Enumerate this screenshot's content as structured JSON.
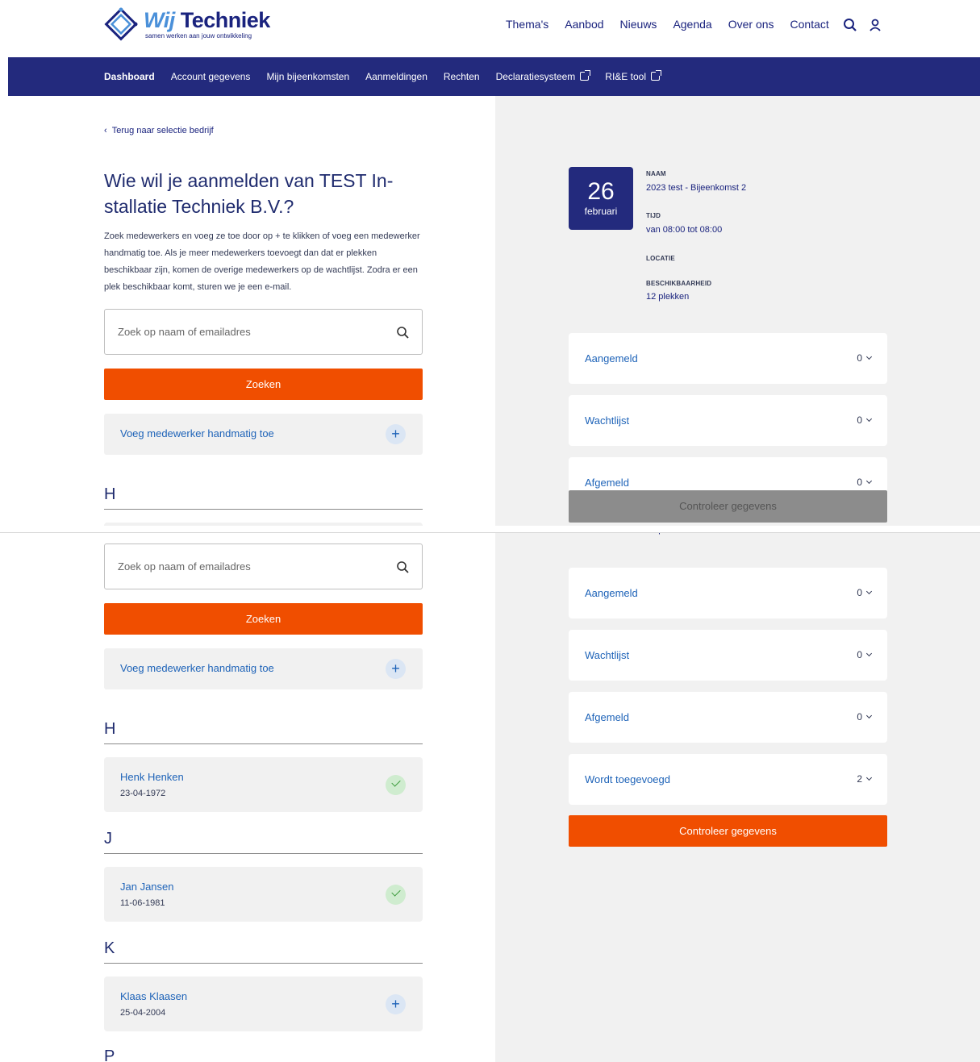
{
  "header": {
    "logo_word1": "Wij",
    "logo_word2": "Techniek",
    "logo_tagline": "samen werken aan jouw ontwikkeling",
    "nav": [
      "Thema's",
      "Aanbod",
      "Nieuws",
      "Agenda",
      "Over ons",
      "Contact"
    ],
    "icons": [
      "search-icon",
      "user-icon"
    ]
  },
  "subnav": {
    "items": [
      "Dashboard",
      "Account gegevens",
      "Mijn bijeenkomsten",
      "Aanmeldingen",
      "Rechten",
      "Declaratiesysteem",
      "RI&E tool"
    ],
    "active": "Dashboard",
    "accent": "#232a7d"
  },
  "left": {
    "back_link": "Terug naar selectie bedrijf",
    "title": "Wie wil je aanmelden van TEST In­stallatie Techniek B.V.?",
    "intro": "Zoek medewerkers en voeg ze toe door op + te klikken of voeg een mede­werker handmatig toe. Als je meer medewerkers toevoegt dan dat er plekken beschikbaar zijn, komen de overige medewerkers op de wacht­lijst. Zodra er een plek beschikbaar komt, sturen we je een e-mail.",
    "search_placeholder": "Zoek op naam of emailadres",
    "search_button": "Zoeken",
    "add_manual": "Voeg medewerker handmatig toe",
    "groups": [
      {
        "letter": "H",
        "people": [
          {
            "name": "Henk Henken",
            "date": "23-04-1972",
            "added": true
          }
        ]
      },
      {
        "letter": "J",
        "people": [
          {
            "name": "Jan Jansen",
            "date": "11-06-1981",
            "added": true
          }
        ]
      },
      {
        "letter": "K",
        "people": [
          {
            "name": "Klaas Klaasen",
            "date": "25-04-2004",
            "added": false
          }
        ]
      },
      {
        "letter": "P",
        "people": []
      }
    ]
  },
  "event": {
    "day": "26",
    "month": "februari",
    "naam_label": "NAAM",
    "naam": "2023 test - Bijeenkomst 2",
    "tijd_label": "TIJD",
    "tijd": "van 08:00 tot 08:00",
    "locatie_label": "LOCATIE",
    "beschikbaarheid_label": "BESCHIKBAARHEID",
    "beschikbaarheid": "12 plekken"
  },
  "status": [
    {
      "label": "Aangemeld",
      "count": "0"
    },
    {
      "label": "Wachtlijst",
      "count": "0"
    },
    {
      "label": "Afgemeld",
      "count": "0"
    },
    {
      "label": "Wordt toegevoegd",
      "count": "2"
    }
  ],
  "check_button": "Controleer gegevens",
  "colors": {
    "orange": "#f04e00",
    "navy": "#232a7d",
    "link": "#1e63b8"
  }
}
